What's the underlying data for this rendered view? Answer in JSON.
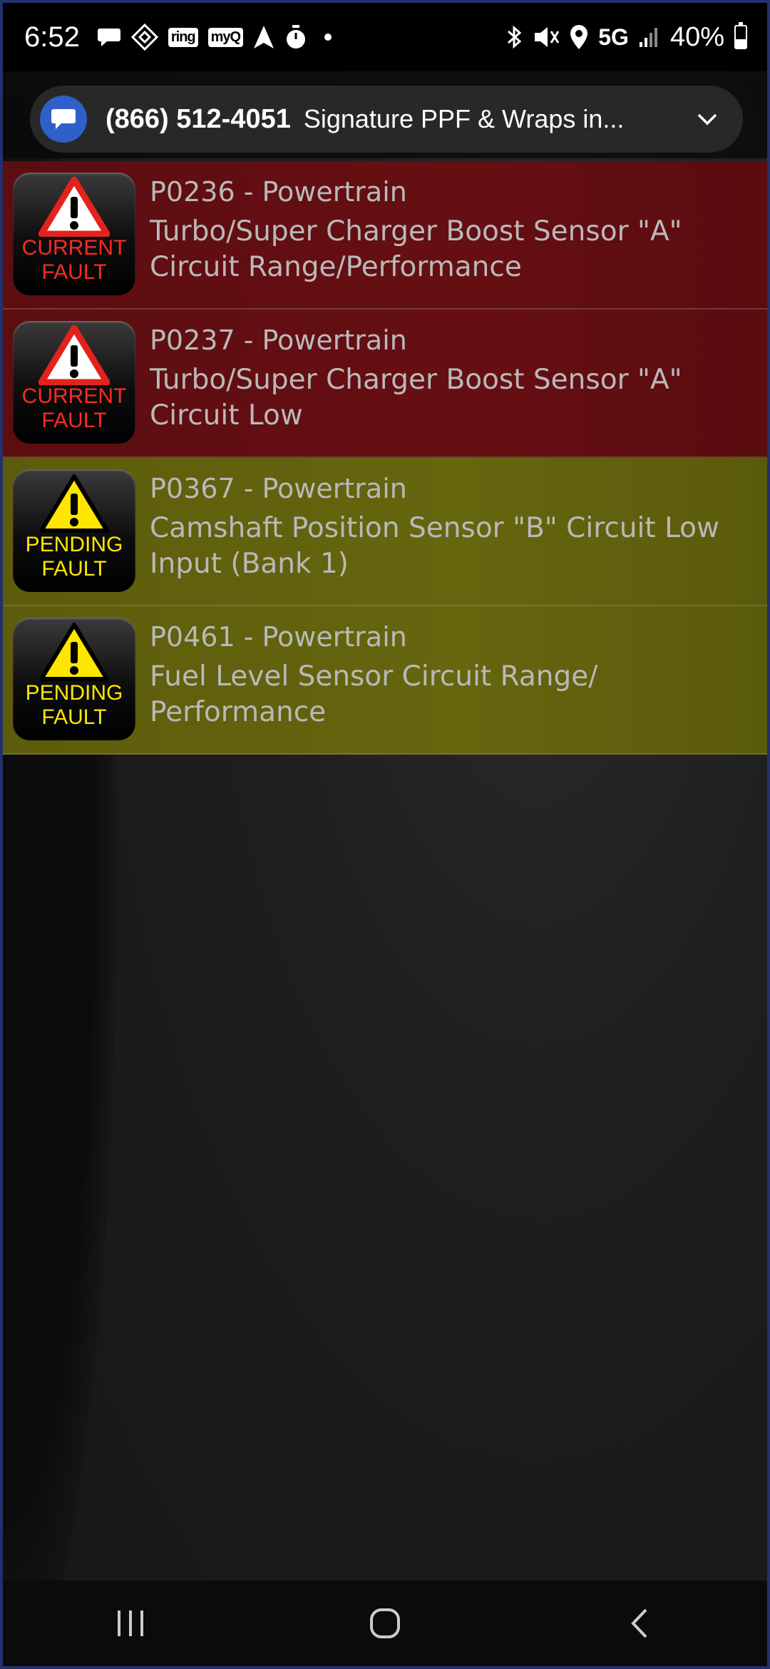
{
  "status_bar": {
    "time": "6:52",
    "notification_icons": [
      "chat-bubble-icon",
      "tag-icon",
      "ring-icon",
      "myq-icon",
      "navigation-arrow-icon",
      "timer-icon"
    ],
    "ring_label": "ring",
    "myq_label": "myQ",
    "network": "5G",
    "battery": "40%",
    "battery_level": 0.4
  },
  "notification": {
    "phone": "(866) 512-4051",
    "text": "Signature PPF & Wraps in...",
    "icon": "chat-bubble-icon",
    "accent_color": "#2f5fc8"
  },
  "faults": [
    {
      "status": "current",
      "badge_line1": "CURRENT",
      "badge_line2": "FAULT",
      "code": "P0236 - Powertrain",
      "description_line1": "Turbo/Super Charger Boost Sensor \"A\"",
      "description_line2": "Circuit Range/Performance"
    },
    {
      "status": "current",
      "badge_line1": "CURRENT",
      "badge_line2": "FAULT",
      "code": "P0237 - Powertrain",
      "description_line1": "Turbo/Super Charger Boost Sensor \"A\"",
      "description_line2": "Circuit Low"
    },
    {
      "status": "pending",
      "badge_line1": "PENDING",
      "badge_line2": "FAULT",
      "code": "P0367 - Powertrain",
      "description_line1": "Camshaft Position Sensor \"B\" Circuit Low",
      "description_line2": "Input (Bank 1)"
    },
    {
      "status": "pending",
      "badge_line1": "PENDING",
      "badge_line2": "FAULT",
      "code": "P0461 - Powertrain",
      "description_line1": "Fuel Level Sensor Circuit Range/",
      "description_line2": "Performance"
    }
  ],
  "colors": {
    "current_row": "#5c0d10",
    "pending_row": "#5c5c0c",
    "current_badge_text": "#ff2a22",
    "pending_badge_text": "#ffe600"
  },
  "nav_bar": {
    "buttons": [
      "recent-apps-icon",
      "home-icon",
      "back-icon"
    ]
  }
}
